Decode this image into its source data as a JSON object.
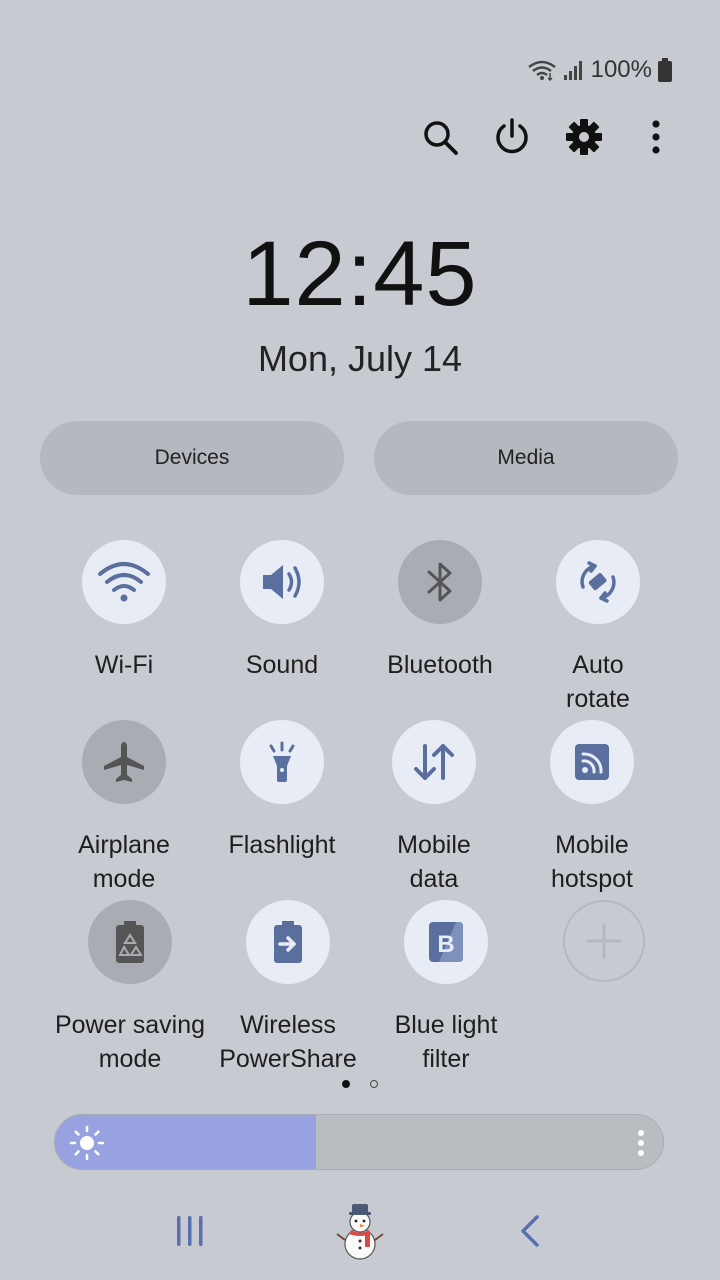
{
  "status_bar": {
    "battery_percent": "100%",
    "icons": [
      "wifi-icon",
      "signal-icon",
      "battery-icon"
    ]
  },
  "header": {
    "actions": [
      {
        "name": "search-icon"
      },
      {
        "name": "power-icon"
      },
      {
        "name": "settings-icon"
      },
      {
        "name": "more-options-icon"
      }
    ]
  },
  "clock": {
    "time": "12:45",
    "date": "Mon, July 14"
  },
  "pills": {
    "devices": "Devices",
    "media": "Media"
  },
  "tiles": [
    {
      "label": "Wi-Fi",
      "icon": "wifi-icon",
      "on": true
    },
    {
      "label": "Sound",
      "icon": "sound-icon",
      "on": true
    },
    {
      "label": "Bluetooth",
      "icon": "bluetooth-icon",
      "on": false
    },
    {
      "label": "Auto\nrotate",
      "icon": "auto-rotate-icon",
      "on": true
    },
    {
      "label": "Airplane\nmode",
      "icon": "airplane-icon",
      "on": false
    },
    {
      "label": "Flashlight",
      "icon": "flashlight-icon",
      "on": true
    },
    {
      "label": "Mobile\ndata",
      "icon": "mobile-data-icon",
      "on": true
    },
    {
      "label": "Mobile\nhotspot",
      "icon": "hotspot-icon",
      "on": true
    },
    {
      "label": "Power saving\nmode",
      "icon": "power-saving-icon",
      "on": false
    },
    {
      "label": "Wireless\nPowerShare",
      "icon": "wireless-powershare-icon",
      "on": true
    },
    {
      "label": "Blue light\nfilter",
      "icon": "blue-light-filter-icon",
      "on": true
    },
    {
      "label": "",
      "icon": "add-icon",
      "on": false
    }
  ],
  "pagination": {
    "current": 1,
    "total": 2
  },
  "brightness": {
    "level": 0.43
  },
  "nav": {
    "items": [
      "recent-apps-icon",
      "home-icon",
      "back-icon"
    ]
  },
  "colors": {
    "background": "#c7cbd1",
    "tile_on": "#e7ecf5",
    "tile_off": "#a9adb3",
    "icon_accent": "#5a6f9e",
    "brightness_fill": "#99a2e0"
  }
}
